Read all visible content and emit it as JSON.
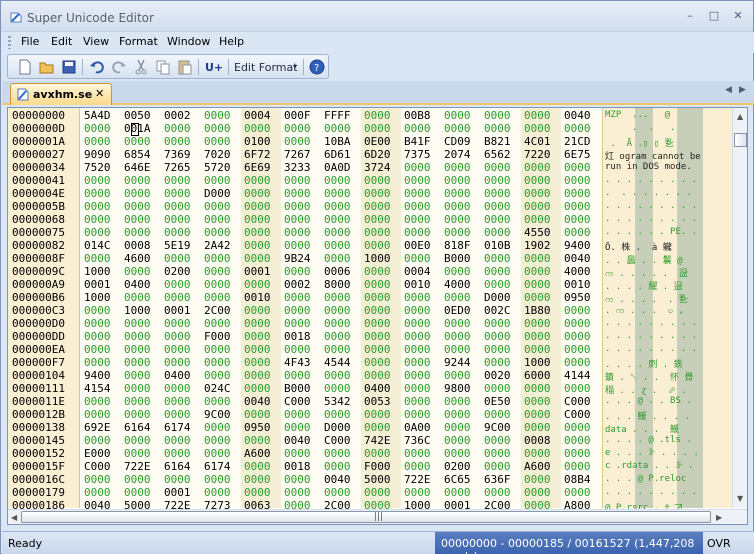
{
  "window": {
    "title": "Super Unicode Editor",
    "minimize": "–",
    "maximize": "□",
    "close": "✕"
  },
  "menu": [
    "File",
    "Edit",
    "View",
    "Format",
    "Window",
    "Help"
  ],
  "toolbar": {
    "edit_format_label": "Edit Format",
    "unicode_label": "U+",
    "icons": [
      "new-file-icon",
      "open-folder-icon",
      "save-icon",
      "undo-icon",
      "redo-icon",
      "cut-icon",
      "copy-icon",
      "paste-icon",
      "unicode-icon",
      "help-icon"
    ]
  },
  "tab": {
    "label": "avxhm.se",
    "close": "✕"
  },
  "editor": {
    "addresses": [
      "00000000",
      "0000000D",
      "0000001A",
      "00000027",
      "00000034",
      "00000041",
      "0000004E",
      "0000005B",
      "00000068",
      "00000075",
      "00000082",
      "0000008F",
      "0000009C",
      "000000A9",
      "000000B6",
      "000000C3",
      "000000D0",
      "000000DD",
      "000000EA",
      "000000F7",
      "00000104",
      "00000111",
      "0000011E",
      "0000012B",
      "00000138",
      "00000145",
      "00000152",
      "0000015F",
      "0000016C",
      "00000179",
      "00000186"
    ],
    "rows": [
      [
        "5A4D",
        "0050",
        "0002",
        "0000",
        "0004",
        "000F",
        "FFFF",
        "0000",
        "00B8",
        "0000",
        "0000",
        "0000",
        "0040"
      ],
      [
        "0000",
        "001A",
        "0000",
        "0000",
        "0000",
        "0000",
        "0000",
        "0000",
        "0000",
        "0000",
        "0000",
        "0000",
        "0000"
      ],
      [
        "0000",
        "0000",
        "0000",
        "0000",
        "0100",
        "0000",
        "10BA",
        "0E00",
        "B41F",
        "CD09",
        "B821",
        "4C01",
        "21CD"
      ],
      [
        "9090",
        "6854",
        "7369",
        "7020",
        "6F72",
        "7267",
        "6D61",
        "6D20",
        "7375",
        "2074",
        "6562",
        "7220",
        "6E75"
      ],
      [
        "7520",
        "646E",
        "7265",
        "5720",
        "6E69",
        "3233",
        "0A0D",
        "3724",
        "0000",
        "0000",
        "0000",
        "0000",
        "0000"
      ],
      [
        "0000",
        "0000",
        "0000",
        "0000",
        "0000",
        "0000",
        "0000",
        "0000",
        "0000",
        "0000",
        "0000",
        "0000",
        "0000"
      ],
      [
        "0000",
        "0000",
        "0000",
        "D000",
        "0000",
        "0000",
        "0000",
        "0000",
        "0000",
        "0000",
        "0000",
        "0000",
        "0000"
      ],
      [
        "0000",
        "0000",
        "0000",
        "0000",
        "0000",
        "0000",
        "0000",
        "0000",
        "0000",
        "0000",
        "0000",
        "0000",
        "0000"
      ],
      [
        "0000",
        "0000",
        "0000",
        "0000",
        "0000",
        "0000",
        "0000",
        "0000",
        "0000",
        "0000",
        "0000",
        "0000",
        "0000"
      ],
      [
        "0000",
        "0000",
        "0000",
        "0000",
        "0000",
        "0000",
        "0000",
        "0000",
        "0000",
        "0000",
        "0000",
        "4550",
        "0000"
      ],
      [
        "014C",
        "0008",
        "5E19",
        "2A42",
        "0000",
        "0000",
        "0000",
        "0000",
        "00E0",
        "818F",
        "010B",
        "1902",
        "9400"
      ],
      [
        "0000",
        "4600",
        "0000",
        "0000",
        "0000",
        "9B24",
        "0000",
        "1000",
        "0000",
        "B000",
        "0000",
        "0000",
        "0040"
      ],
      [
        "1000",
        "0000",
        "0200",
        "0000",
        "0001",
        "0000",
        "0006",
        "0000",
        "0004",
        "0000",
        "0000",
        "0000",
        "4000"
      ],
      [
        "0001",
        "0400",
        "0000",
        "0000",
        "0000",
        "0002",
        "8000",
        "0000",
        "0010",
        "4000",
        "0000",
        "0000",
        "0010"
      ],
      [
        "1000",
        "0000",
        "0000",
        "0000",
        "0010",
        "0000",
        "0000",
        "0000",
        "0000",
        "0000",
        "D000",
        "0000",
        "0950"
      ],
      [
        "0000",
        "1000",
        "0001",
        "2C00",
        "0000",
        "0000",
        "0000",
        "0000",
        "0000",
        "0ED0",
        "002C",
        "1B80",
        "0000"
      ],
      [
        "0000",
        "0000",
        "0000",
        "0000",
        "0000",
        "0000",
        "0000",
        "0000",
        "0000",
        "0000",
        "0000",
        "0000",
        "0000"
      ],
      [
        "0000",
        "0000",
        "0000",
        "F000",
        "0000",
        "0018",
        "0000",
        "0000",
        "0000",
        "0000",
        "0000",
        "0000",
        "0000"
      ],
      [
        "0000",
        "0000",
        "0000",
        "0000",
        "0000",
        "0000",
        "0000",
        "0000",
        "0000",
        "0000",
        "0000",
        "0000",
        "0000"
      ],
      [
        "0000",
        "0000",
        "0000",
        "0000",
        "0000",
        "4F43",
        "4544",
        "0000",
        "0000",
        "9244",
        "0000",
        "1000",
        "0000"
      ],
      [
        "9400",
        "0000",
        "0400",
        "0000",
        "0000",
        "0000",
        "0000",
        "0000",
        "0000",
        "0000",
        "0020",
        "6000",
        "4144"
      ],
      [
        "4154",
        "0000",
        "0000",
        "024C",
        "0000",
        "B000",
        "0000",
        "0400",
        "0000",
        "9800",
        "0000",
        "0000",
        "0000"
      ],
      [
        "0000",
        "0000",
        "0000",
        "0000",
        "0040",
        "C000",
        "5342",
        "0053",
        "0000",
        "0000",
        "0E50",
        "0000",
        "C000"
      ],
      [
        "0000",
        "0000",
        "0000",
        "9C00",
        "0000",
        "0000",
        "0000",
        "0000",
        "0000",
        "0000",
        "0000",
        "0000",
        "C000"
      ],
      [
        "692E",
        "6164",
        "6174",
        "0000",
        "0950",
        "0000",
        "D000",
        "0000",
        "0A00",
        "0000",
        "9C00",
        "0000",
        "0000"
      ],
      [
        "0000",
        "0000",
        "0000",
        "0000",
        "0000",
        "0040",
        "C000",
        "742E",
        "736C",
        "0000",
        "0000",
        "0008",
        "0000"
      ],
      [
        "E000",
        "0000",
        "0000",
        "0000",
        "A600",
        "0000",
        "0000",
        "0000",
        "0000",
        "0000",
        "0000",
        "0000",
        "0000"
      ],
      [
        "C000",
        "722E",
        "6164",
        "6174",
        "0000",
        "0018",
        "0000",
        "F000",
        "0000",
        "0200",
        "0000",
        "A600",
        "0000"
      ],
      [
        "0000",
        "0000",
        "0000",
        "0000",
        "0000",
        "0000",
        "0040",
        "5000",
        "722E",
        "6C65",
        "636F",
        "0000",
        "08B4"
      ],
      [
        "0000",
        "0000",
        "0001",
        "0000",
        "0000",
        "0000",
        "0000",
        "0000",
        "0000",
        "0000",
        "0000",
        "0000",
        "0000"
      ],
      [
        "0040",
        "5000",
        "722E",
        "7273",
        "0063",
        "0000",
        "2C00",
        "0000",
        "1000",
        "0001",
        "2C00",
        "0000",
        "A800"
      ]
    ],
    "chars": [
      "MZP  ...   @",
      "     .  .   .",
      " .  Ā .▯ ▯ 㐠",
      "灴 ogram cannot be",
      "run in DOS mode. ",
      ". . . . . . . . .",
      ".  . . . . . . .",
      ". . . . . . . . .",
      ". . . . . . . . .",
      ". . . . . . PE. .",
      "Ō. 株 .  à 䡁 ",
      ". . 䘀 . . 鬤 @",
      "က . . . . .  䀀",
      ". . . . 耀 . 䀀",
      "က . . . .  . 㐠",
      ". က . . .  ဎ ,",
      ". . . . . . . . .",
      ". . . . . . . . .",
      ". . . . . . . . .",
      ". . . . 剫 . 鉄",
      "鐀 . ␀ . .  怀 䑁",
      "䅔 . . ɀ .  ⬀ .",
      ". . . @ . . BS .",
      ". . . 鰀 . . . .",
      "data . . .  鰀",
      ". . . . @ .tls .",
      "e . . . ꘀ . . . .",
      "c .rdata . . ꘀ .",
      ". . . @ P.reloc",
      ". . . . . . . . .",
      "@ P.rsrc . ⰰ ꠀ"
    ]
  },
  "status": {
    "ready": "Ready",
    "position": "00000000 - 00000185 / 00161527 (1,447,208 words)",
    "mode": "OVR"
  }
}
